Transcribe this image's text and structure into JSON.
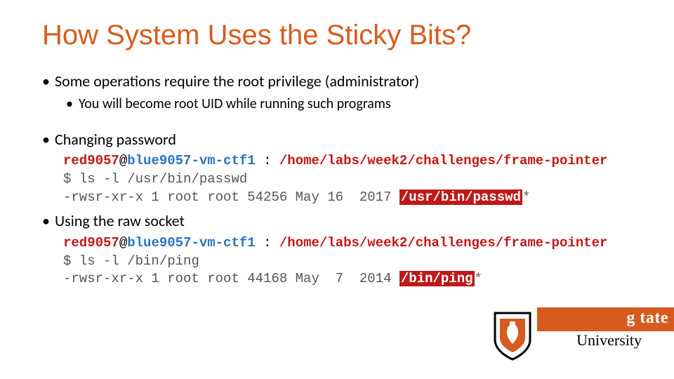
{
  "title": "How System Uses the Sticky Bits?",
  "bullets": {
    "b1": "Some operations require the root privilege (administrator)",
    "b1a": "You will become root UID while running such programs",
    "b2": "Changing password",
    "b3": "Using the raw socket"
  },
  "term1": {
    "user": "red9057",
    "at": "@",
    "host": "blue9057-vm-ctf1",
    "sep": " : ",
    "cwd": "/home/labs/week2/challenges/frame-pointer",
    "prompt": "$ ",
    "cmd": "ls -l /usr/bin/passwd",
    "out_pre": "-rwsr-xr-x 1 root root 54256 May 16  2017 ",
    "out_hl": "/usr/bin/passwd",
    "out_post": "*"
  },
  "term2": {
    "user": "red9057",
    "at": "@",
    "host": "blue9057-vm-ctf1",
    "sep": " : ",
    "cwd": "/home/labs/week2/challenges/frame-pointer",
    "prompt": "$ ",
    "cmd": "ls -l /bin/ping",
    "out_pre": "-rwsr-xr-x 1 root root 44168 May  7  2014 ",
    "out_hl": "/bin/ping",
    "out_post": "*"
  },
  "logo": {
    "line1_fragment": "g   tate",
    "line2": "University"
  }
}
